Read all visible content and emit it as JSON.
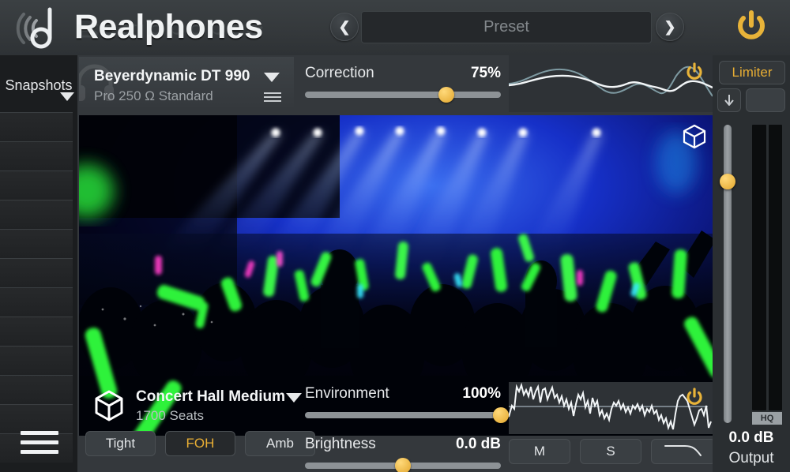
{
  "app": {
    "title": "Realphones",
    "logo_icon": "realphones-logo-icon",
    "power_icon": "power-icon"
  },
  "preset": {
    "prev_icon": "chevron-left-icon",
    "next_icon": "chevron-right-icon",
    "placeholder": "Preset",
    "value": "Preset"
  },
  "sidebar": {
    "title": "Snapshots",
    "caret_icon": "chevron-down-icon",
    "menu_icon": "hamburger-menu-icon",
    "slot_count": 12
  },
  "headphone": {
    "name": "Beyerdynamic DT 990",
    "sub": "Pro 250 Ω Standard",
    "caret_icon": "chevron-down-icon",
    "list_icon": "list-icon",
    "ghost_icon": "headphones-icon"
  },
  "correction": {
    "label": "Correction",
    "value": "75%",
    "percent": 72,
    "power_icon": "power-icon"
  },
  "viewport": {
    "cube_icon": "cube-3d-icon",
    "scene": "concert-hall-stage-crowd"
  },
  "environment": {
    "name": "Concert Hall Medium",
    "sub": "1700 Seats",
    "caret_icon": "chevron-down-icon",
    "cube_icon": "cube-3d-icon",
    "modes": [
      {
        "label": "Tight",
        "active": false
      },
      {
        "label": "FOH",
        "active": true
      },
      {
        "label": "Amb",
        "active": false
      }
    ],
    "amount": {
      "label": "Environment",
      "value": "100%",
      "percent": 100
    },
    "brightness": {
      "label": "Brightness",
      "value": "0.0 dB",
      "percent": 50
    },
    "power_icon": "power-icon",
    "buttons": [
      {
        "label": "M",
        "name": "mid-button"
      },
      {
        "label": "S",
        "name": "side-button"
      },
      {
        "label": "",
        "name": "lowpass-filter-button",
        "icon": "lowpass-curve-icon"
      }
    ]
  },
  "output": {
    "limiter_label": "Limiter",
    "download_icon": "arrow-down-icon",
    "blank_label": "",
    "fader_percent": 19,
    "hq_label": "HQ",
    "value": "0.0 dB",
    "label": "Output"
  },
  "colors": {
    "accent": "#e8ae34",
    "panel": "#34383c",
    "sidebar": "#1b1d1f",
    "track": "#8d9296",
    "text": "#f4f6f7"
  }
}
